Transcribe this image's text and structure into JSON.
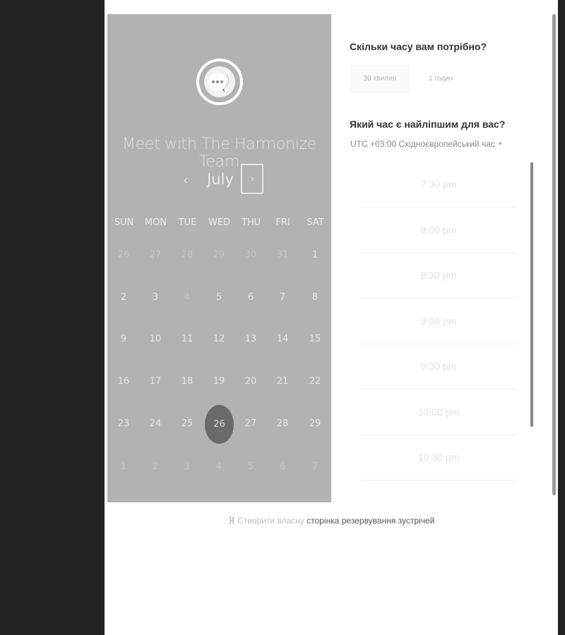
{
  "calendar": {
    "title": "Meet with The Harmonize Team",
    "month": "July",
    "prev_icon": "‹",
    "next_icon": "›",
    "weekdays": [
      "SUN",
      "MON",
      "TUE",
      "WED",
      "THU",
      "FRI",
      "SAT"
    ],
    "weeks": [
      [
        "26",
        "27",
        "28",
        "29",
        "30",
        "31",
        "1"
      ],
      [
        "2",
        "3",
        "4",
        "5",
        "6",
        "7",
        "8"
      ],
      [
        "9",
        "10",
        "11",
        "12",
        "13",
        "14",
        "15"
      ],
      [
        "16",
        "17",
        "18",
        "19",
        "20",
        "21",
        "22"
      ],
      [
        "23",
        "24",
        "25",
        "26",
        "27",
        "28",
        "29"
      ],
      [
        "1",
        "2",
        "3",
        "4",
        "5",
        "6",
        "7"
      ]
    ],
    "selected_day": "26"
  },
  "duration": {
    "question": "Скільки часу вам потрібно?",
    "options": [
      "30 хвилин",
      "1 годин"
    ]
  },
  "time": {
    "question": "Який час є найліпшим для вас?",
    "timezone": "UTC +03:00 Східноєвропейський час",
    "slots": [
      "7:30 pm",
      "8:00 pm",
      "8:30 pm",
      "9:00 pm",
      "9:30 pm",
      "10:00 pm",
      "10:30 pm"
    ]
  },
  "footer": {
    "icon": "ⴼ",
    "light_text": "Створити власну",
    "bold_text": "сторінка резервування зустрічей"
  },
  "colors": {
    "calendar_panel": "#b2b2b2",
    "selected_day": "#6a6a6a",
    "sidebar_dark": "#222222"
  }
}
